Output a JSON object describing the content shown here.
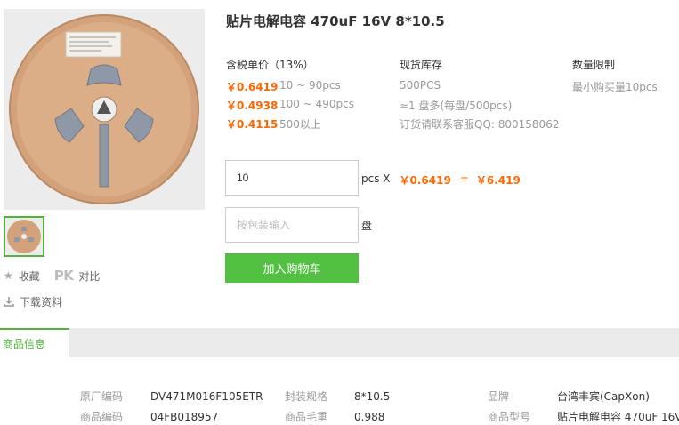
{
  "product": {
    "title": "贴片电解电容 470uF 16V 8*10.5"
  },
  "pricing": {
    "header": "含税单价（13%）",
    "tiers": [
      {
        "price": "￥0.6419",
        "range": "10 ~ 90pcs"
      },
      {
        "price": "￥0.4938",
        "range": "100 ~ 490pcs"
      },
      {
        "price": "￥0.4115",
        "range": "500以上"
      }
    ]
  },
  "stock": {
    "header": "现货库存",
    "qty": "500PCS",
    "reel": "≈1 盘多(每盘/500pcs)",
    "contact": "订货请联系客服QQ: 800158062"
  },
  "limit": {
    "header": "数量限制",
    "text": "最小购买量10pcs"
  },
  "order": {
    "qty_value": "10",
    "unit": "pcs X",
    "unit_price": "￥0.6419",
    "equals": "=",
    "total": "￥6.419",
    "pack_placeholder": "按包装输入",
    "pack_unit": "盘",
    "cart_label": "加入购物车"
  },
  "actions": {
    "favorite": "收藏",
    "pk": "PK",
    "compare": "对比",
    "download": "下载资料"
  },
  "tabs": {
    "active": "商品信息"
  },
  "specs": {
    "mfr_code_label": "原厂编码",
    "mfr_code": "DV471M016F105ETR",
    "package_label": "封装规格",
    "package": "8*10.5",
    "brand_label": "品牌",
    "brand": "台湾丰宾(CapXon)",
    "sku_label": "商品编码",
    "sku": "04FB018957",
    "weight_label": "商品毛重",
    "weight": "0.988",
    "model_label": "商品型号",
    "model": "贴片电解电容 470uF 16V"
  },
  "colors": {
    "accent_green": "#52c041",
    "price_orange": "#ff6600"
  }
}
